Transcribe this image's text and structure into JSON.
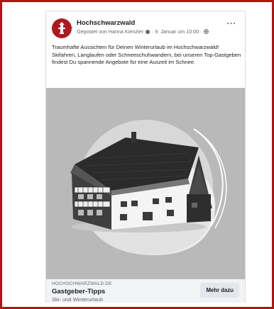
{
  "colors": {
    "frame_border": "#b31212",
    "avatar_bg": "#b0181d",
    "media_bg": "#b9b9b9",
    "footer_bg": "#f2f3f5",
    "cta_bg": "#e4e6eb"
  },
  "post": {
    "page_name": "Hochschwarzwald",
    "meta_posted_by": "Gepostet von Hanna Kienzler",
    "meta_date": "· 9. Januar um 10:00 ·",
    "more_icon": "ellipsis-icon",
    "text": "Traumhafte Aussichten für Deinen Winterurlaub im Hochschwarzwald! Skifahren, Langlaufen oder Schneeschuhwandern, bei unseren Top-Gastgeben findest Du spannende Angebote für eine Auszeit im Schnee."
  },
  "link_preview": {
    "domain": "HOCHSCHWARZWALD.DE",
    "title": "Gastgeber-Tipps",
    "description": "Ski- und Winterurlaub",
    "cta_label": "Mehr dazu"
  }
}
